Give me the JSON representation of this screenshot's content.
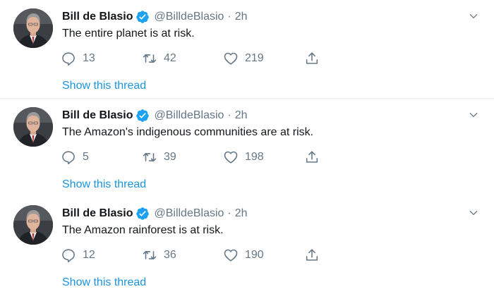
{
  "colors": {
    "accent": "#1b95e0",
    "verified": "#1da1f2",
    "muted": "#657786",
    "text": "#14171a",
    "divider": "#e6ecf0"
  },
  "tweets": [
    {
      "name": "Bill de Blasio",
      "handle": "@BilldeBlasio",
      "separator": "·",
      "time": "2h",
      "text": "The entire planet is at risk.",
      "replies": "13",
      "retweets": "42",
      "likes": "219",
      "thread_label": "Show this thread",
      "icons": [
        "reply-icon",
        "retweet-icon",
        "like-icon",
        "share-icon",
        "verified-icon",
        "chevron-down-icon"
      ]
    },
    {
      "name": "Bill de Blasio",
      "handle": "@BilldeBlasio",
      "separator": "·",
      "time": "2h",
      "text": "The Amazon's indigenous communities are at risk.",
      "replies": "5",
      "retweets": "39",
      "likes": "198",
      "thread_label": "Show this thread",
      "icons": [
        "reply-icon",
        "retweet-icon",
        "like-icon",
        "share-icon",
        "verified-icon",
        "chevron-down-icon"
      ]
    },
    {
      "name": "Bill de Blasio",
      "handle": "@BilldeBlasio",
      "separator": "·",
      "time": "2h",
      "text": "The Amazon rainforest is at risk.",
      "replies": "12",
      "retweets": "36",
      "likes": "190",
      "thread_label": "Show this thread",
      "icons": [
        "reply-icon",
        "retweet-icon",
        "like-icon",
        "share-icon",
        "verified-icon",
        "chevron-down-icon"
      ]
    }
  ]
}
